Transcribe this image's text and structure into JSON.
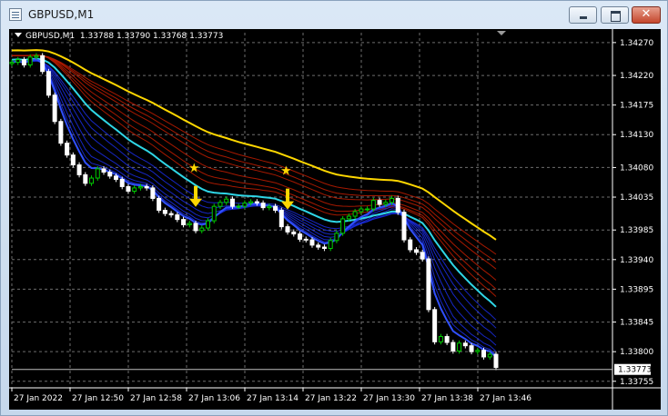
{
  "window": {
    "title": "GBPUSD,M1",
    "close_glyph": "✕"
  },
  "chart": {
    "symbol_line": "GBPUSD,M1  1.33788 1.33790 1.33768 1.33773",
    "price_labels": [
      "1.34270",
      "1.34220",
      "1.34175",
      "1.34130",
      "1.34080",
      "1.34035",
      "1.33985",
      "1.33940",
      "1.33895",
      "1.33845",
      "1.33800",
      "1.33755"
    ],
    "current_price": "1.33773",
    "time_labels": [
      "27 Jan 2022",
      "27 Jan 12:50",
      "27 Jan 12:58",
      "27 Jan 13:06",
      "27 Jan 13:14",
      "27 Jan 13:22",
      "27 Jan 13:30",
      "27 Jan 13:38",
      "27 Jan 13:46"
    ]
  },
  "chart_data": {
    "type": "candlestick",
    "symbol": "GBPUSD",
    "timeframe": "M1",
    "ylim": [
      1.33745,
      1.34285
    ],
    "yticks": [
      1.3427,
      1.3422,
      1.34175,
      1.3413,
      1.3408,
      1.34035,
      1.33985,
      1.3394,
      1.33895,
      1.33845,
      1.338,
      1.33755
    ],
    "last_price": 1.33773,
    "close": [
      1.3424,
      1.34244,
      1.34236,
      1.34248,
      1.3425,
      1.34226,
      1.3419,
      1.3415,
      1.34117,
      1.34099,
      1.34084,
      1.34069,
      1.34056,
      1.34064,
      1.34078,
      1.34073,
      1.34067,
      1.34062,
      1.34051,
      1.34044,
      1.34049,
      1.34051,
      1.34049,
      1.34033,
      1.34015,
      1.3401,
      1.34008,
      1.34001,
      1.33993,
      1.33995,
      1.33984,
      1.33988,
      1.33999,
      1.34021,
      1.34027,
      1.34032,
      1.34021,
      1.34021,
      1.34026,
      1.34028,
      1.34026,
      1.34019,
      1.34021,
      1.34015,
      1.3399,
      1.33982,
      1.33979,
      1.33971,
      1.3397,
      1.33962,
      1.33959,
      1.33957,
      1.33969,
      1.3398,
      1.34002,
      1.34006,
      1.34013,
      1.34017,
      1.34017,
      1.3403,
      1.34024,
      1.34027,
      1.34033,
      1.34012,
      1.3397,
      1.33955,
      1.33951,
      1.33941,
      1.33864,
      1.33815,
      1.33823,
      1.33814,
      1.33801,
      1.33813,
      1.33809,
      1.338,
      1.33802,
      1.33792,
      1.33796,
      1.33776
    ],
    "ma_channels": [
      {
        "color": "#ffd700",
        "role": "upper"
      },
      {
        "color": "#cc2200",
        "role": "upper-band"
      },
      {
        "color": "#2fd6e6",
        "role": "lower"
      },
      {
        "color": "#2233ff",
        "role": "lower-band"
      }
    ],
    "signals": [
      {
        "type": "sell-arrow",
        "bar": 30,
        "price": 1.34052
      },
      {
        "type": "sell-arrow",
        "bar": 45,
        "price": 1.34048
      }
    ],
    "colors": {
      "bull": "#00cc00",
      "bear": "#ffffff",
      "grid": "#6e6e6e",
      "axis": "#ffffff",
      "signal": "#ffd700",
      "background": "#000000"
    }
  }
}
